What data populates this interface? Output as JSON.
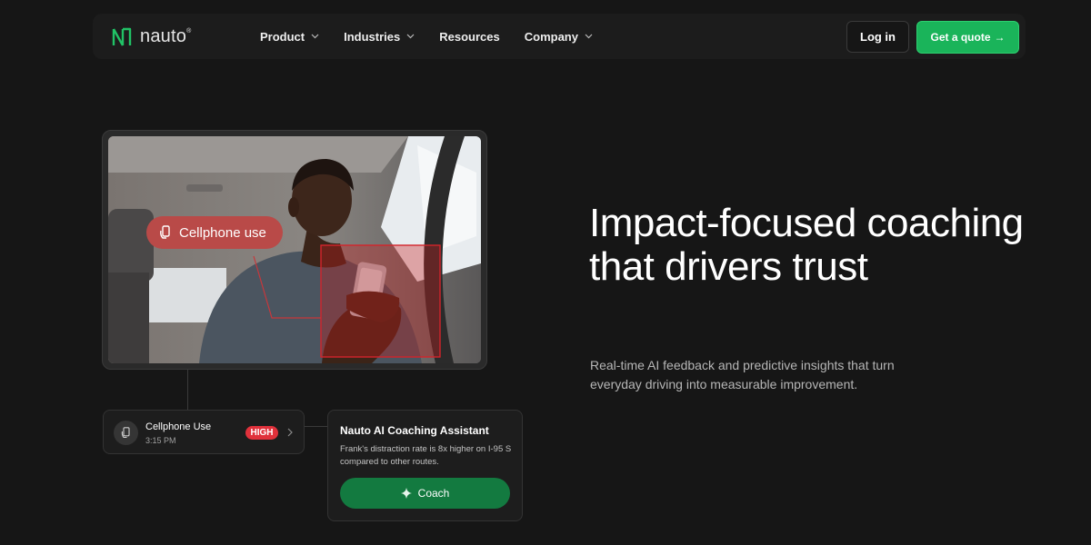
{
  "nav": {
    "logo_text": "nauto",
    "logo_mark": "®",
    "links": [
      {
        "label": "Product",
        "has_dropdown": true
      },
      {
        "label": "Industries",
        "has_dropdown": true
      },
      {
        "label": "Resources",
        "has_dropdown": false
      },
      {
        "label": "Company",
        "has_dropdown": true
      }
    ],
    "login_label": "Log in",
    "quote_label": "Get a quote",
    "quote_arrow": "→"
  },
  "video": {
    "detection_label": "Cellphone use"
  },
  "event": {
    "title": "Cellphone Use",
    "time": "3:15 PM",
    "severity": "HIGH"
  },
  "assistant": {
    "title": "Nauto AI Coaching Assistant",
    "message": "Frank's distraction rate is 8x higher on I-95 S compared to other routes.",
    "button_label": "Coach"
  },
  "hero": {
    "title": "Impact-focused coaching that drivers trust",
    "subtitle": "Real-time AI feedback and predictive insights that turn everyday driving into measurable improvement."
  },
  "colors": {
    "background": "#161616",
    "accent_green": "#1ab45a",
    "coach_green": "#137a40",
    "alert_red": "#e0313b",
    "detection_red": "#b94a48"
  },
  "icons": [
    "nauto-logo-icon",
    "chevron-down-icon",
    "phone-hand-icon",
    "chevron-right-icon",
    "sparkle-icon"
  ]
}
